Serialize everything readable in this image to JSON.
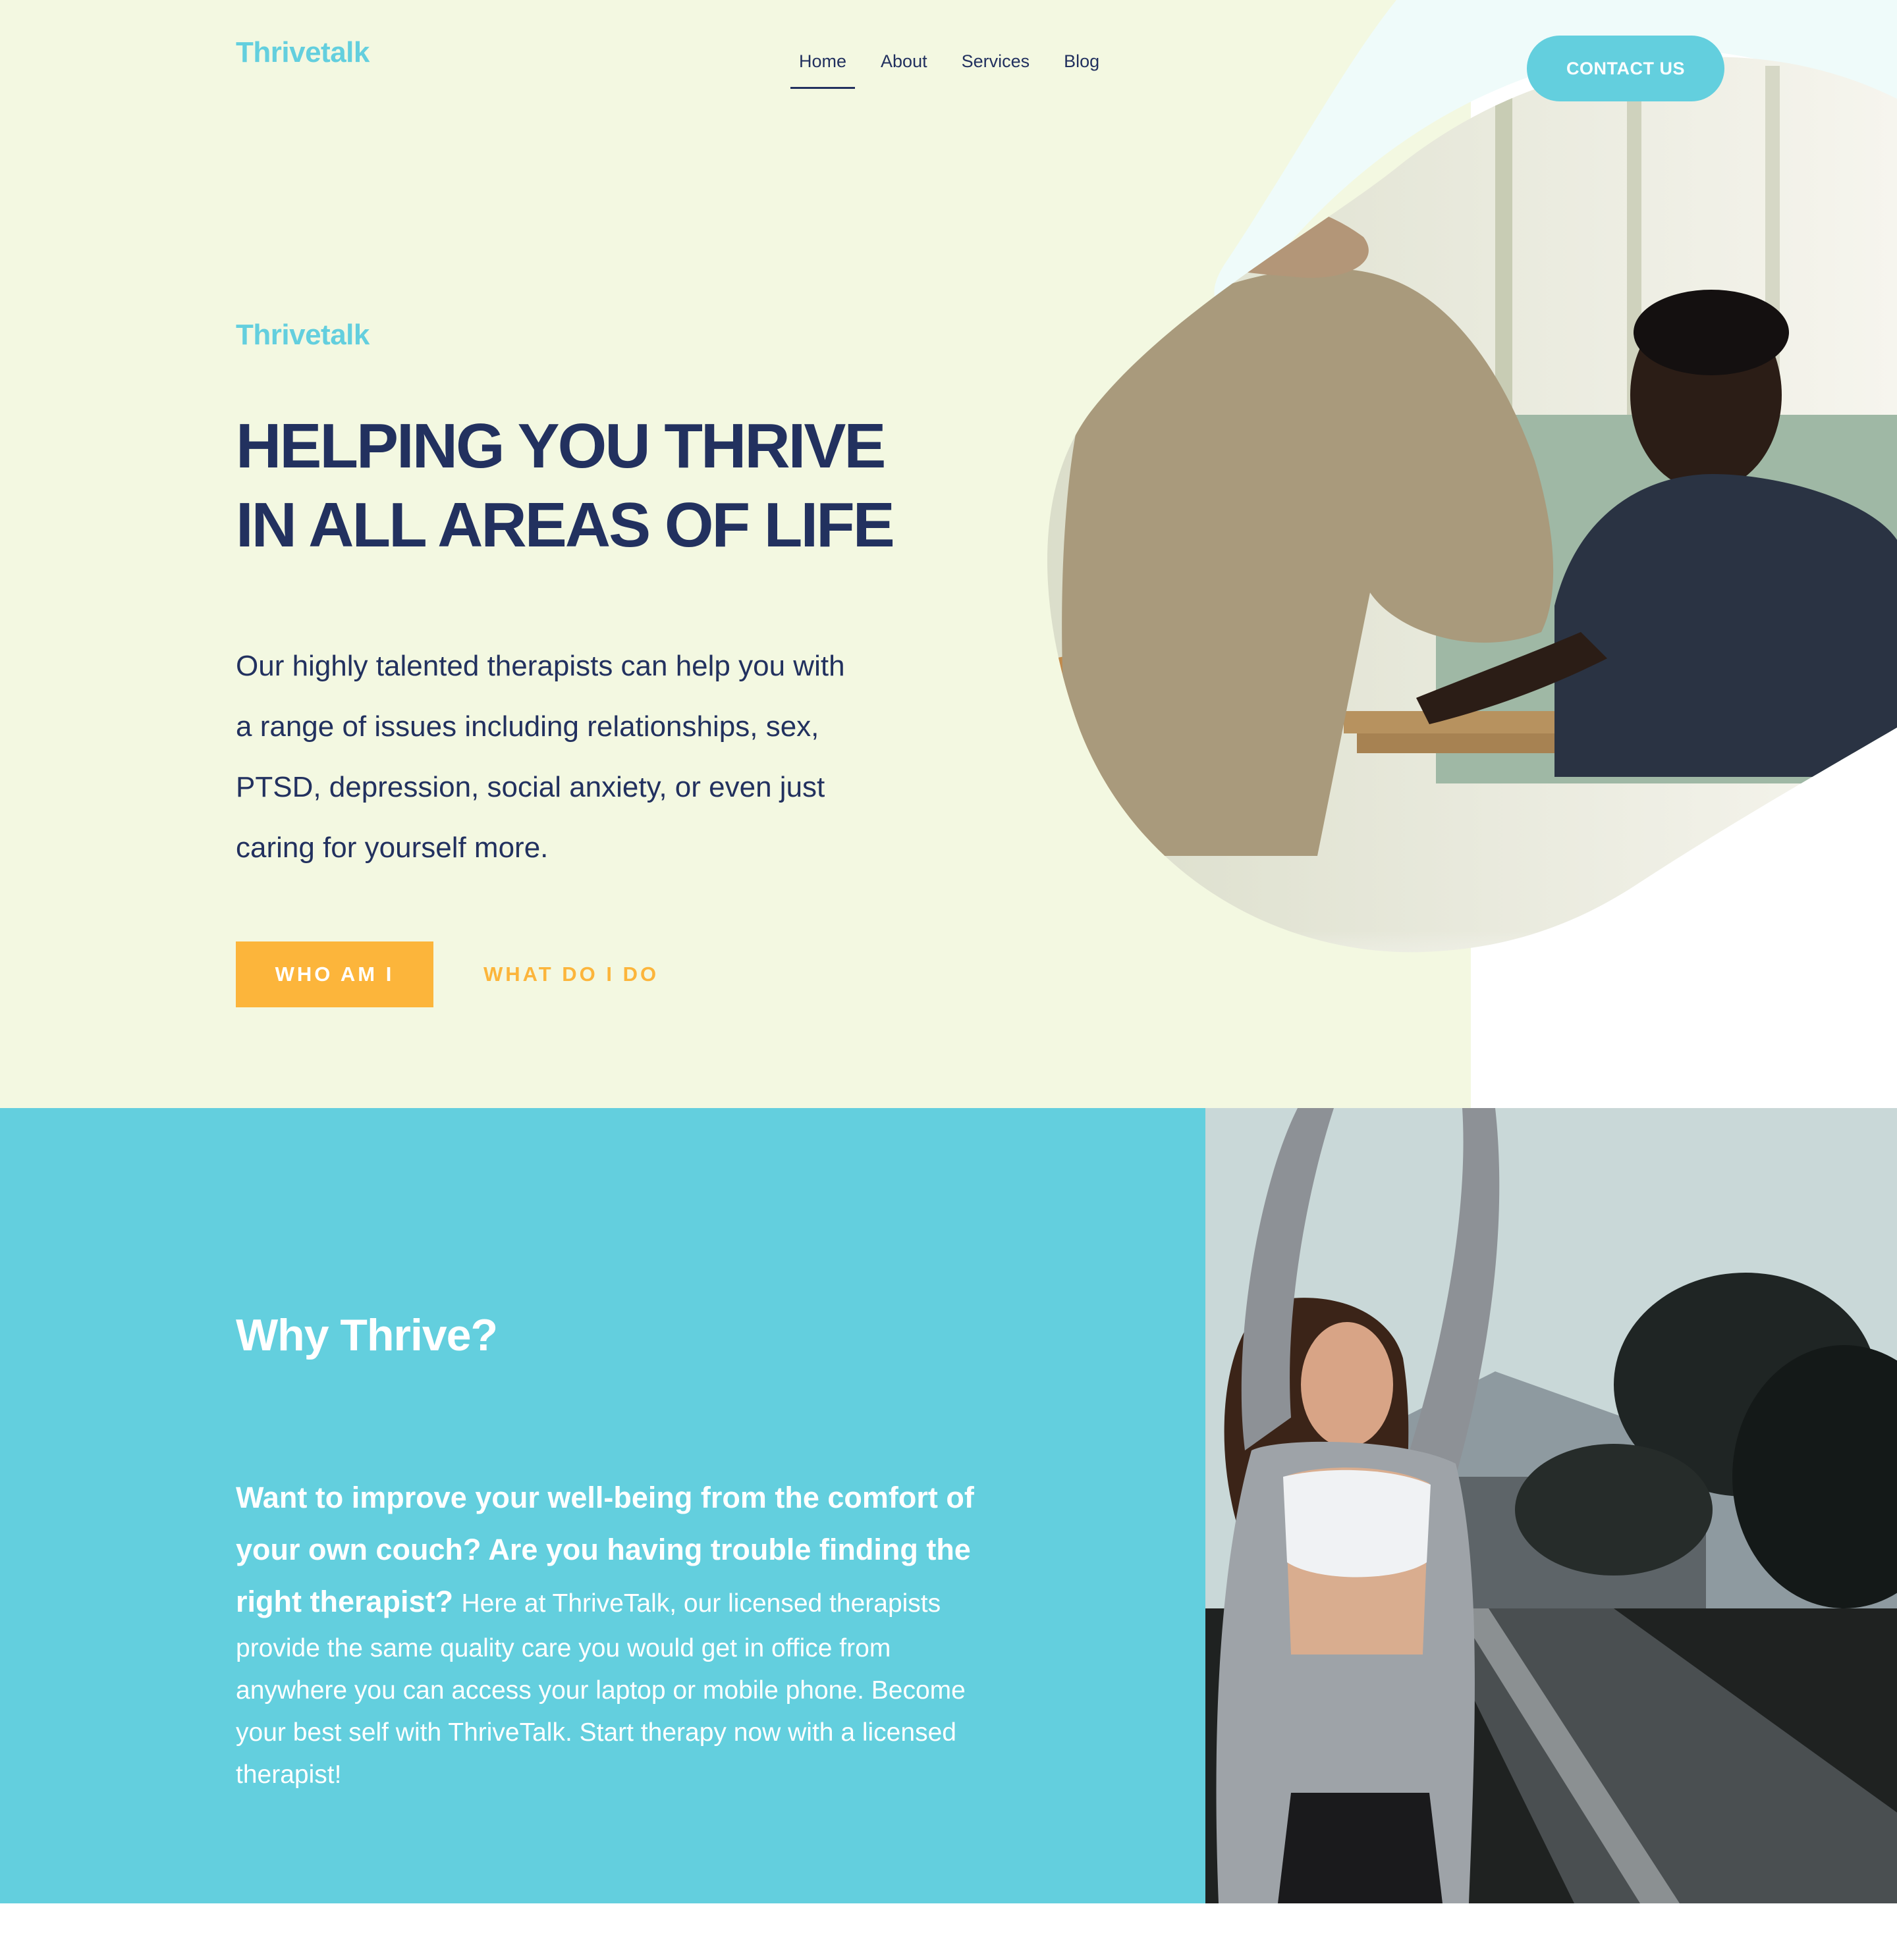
{
  "brand": {
    "name": "Thrivetalk",
    "colors": {
      "accent": "#63cfde",
      "navy": "#22315f",
      "cta": "#fcb53b",
      "hero_bg": "#f3f8e1"
    }
  },
  "nav": {
    "items": [
      {
        "label": "Home",
        "active": true
      },
      {
        "label": "About",
        "active": false
      },
      {
        "label": "Services",
        "active": false
      },
      {
        "label": "Blog",
        "active": false
      }
    ],
    "contact_label": "CONTACT US"
  },
  "hero": {
    "eyebrow": "Thrivetalk",
    "headline_line1": "HELPING YOU THRIVE",
    "headline_line2": "IN ALL AREAS OF LIFE",
    "body": "Our highly talented therapists can help you with a range of issues including relationships, sex, PTSD, depression, social anxiety, or even just caring for yourself more.",
    "primary_button": "WHO AM I",
    "secondary_button": "WHAT DO I DO"
  },
  "why": {
    "title": "Why Thrive?",
    "lead": "Want to improve your well-being from the comfort of your own couch? Are you having trouble finding the right therapist?",
    "body": "Here at ThriveTalk, our licensed therapists provide the same quality care you would get in office from anywhere you can access your laptop or mobile phone. Become your best self with ThriveTalk.  Start therapy now with a licensed therapist!"
  }
}
